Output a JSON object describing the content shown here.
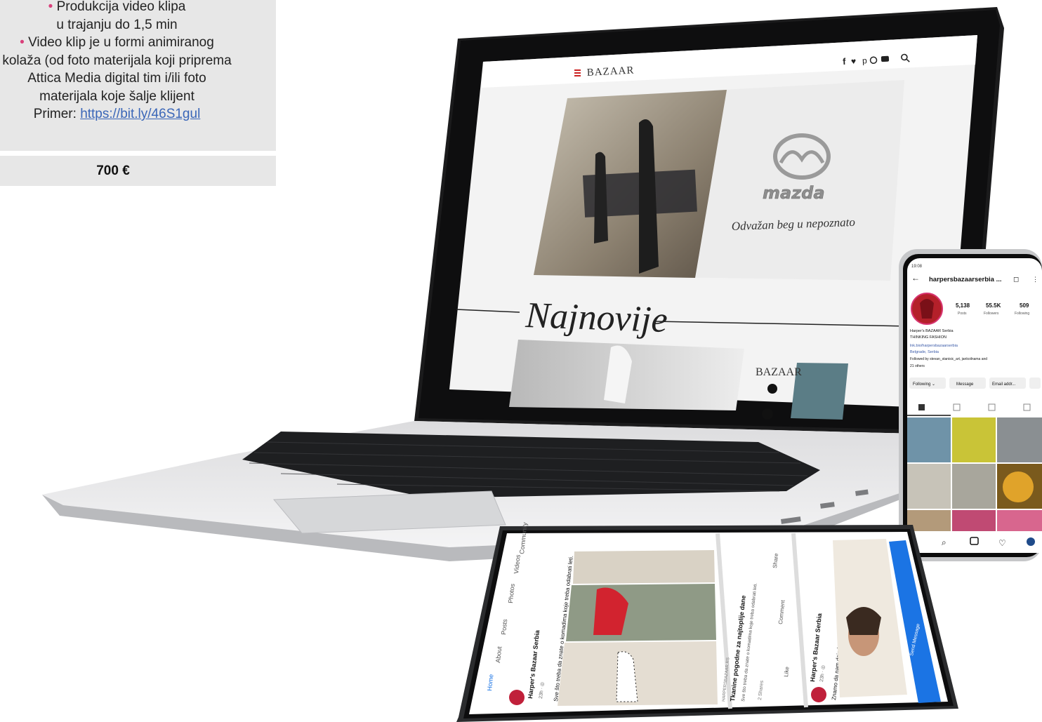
{
  "offer": {
    "line1_bullet": "•",
    "line1": " Produkcija video klipa",
    "line2": "u trajanju do 1,5 min",
    "line3_bullet": "•",
    "line3": " Video klip je u formi animiranog",
    "line4": "kolaža (od foto materijala koji priprema",
    "line5": "Attica Media digital tim i/ili foto",
    "line6": "materijala koje šalje klijent",
    "example_label": "Primer: ",
    "example_link": "https://bit.ly/46S1gul",
    "price": "700 €"
  },
  "laptop_site": {
    "logo": "BAZAAR",
    "social_icons": [
      "facebook-icon",
      "twitter-icon",
      "pinterest-icon",
      "instagram-icon",
      "youtube-icon",
      "search-icon"
    ],
    "ad_brand": "mazda",
    "ad_slogan": "Odvažan beg u nepoznato",
    "section_title": "Najnovije",
    "side_logo": "BAZAAR"
  },
  "phone_instagram": {
    "status_time": "19:08",
    "username": "harpersbazaarserbia ...",
    "posts_count": "5,138",
    "posts_label": "Posts",
    "followers_count": "55.5K",
    "followers_label": "Followers",
    "following_count": "509",
    "following_label": "Following",
    "bio_name": "Harper's BAZAAR Serbia",
    "bio_line1": "THINKING FASHION",
    "bio_link": "lnk.bio/harpersbazaarserbia",
    "bio_location": "Belgrade, Serbia",
    "bio_followed": "Followed by stevan_stanisic_art, jankoilnama and",
    "bio_followed2": "21 others",
    "btn_following": "Following ⌄",
    "btn_message": "Message",
    "btn_email": "Email addr..."
  },
  "tablet_facebook": {
    "tab_home": "Home",
    "tab_about": "About",
    "tab_posts": "Posts",
    "tab_photos": "Photos",
    "tab_videos": "Videos",
    "tab_community": "Community",
    "page_name": "Harper's Bazaar Serbia",
    "post1_text": "Sve što treba da znate o komadima koje treba odabrati leti.",
    "post2_title": "Tkanine pogodne za najtoplije dane",
    "post2_sub": "Sve što treba da znate o komadima koje treba odabrati leti.",
    "post3_text": "Znamo da nam daje brze rezultate, ali po kojoj ceni?",
    "like": "Like",
    "comment": "Comment",
    "share": "Share",
    "send_message": "Send Message",
    "time": "23h · ◎"
  }
}
